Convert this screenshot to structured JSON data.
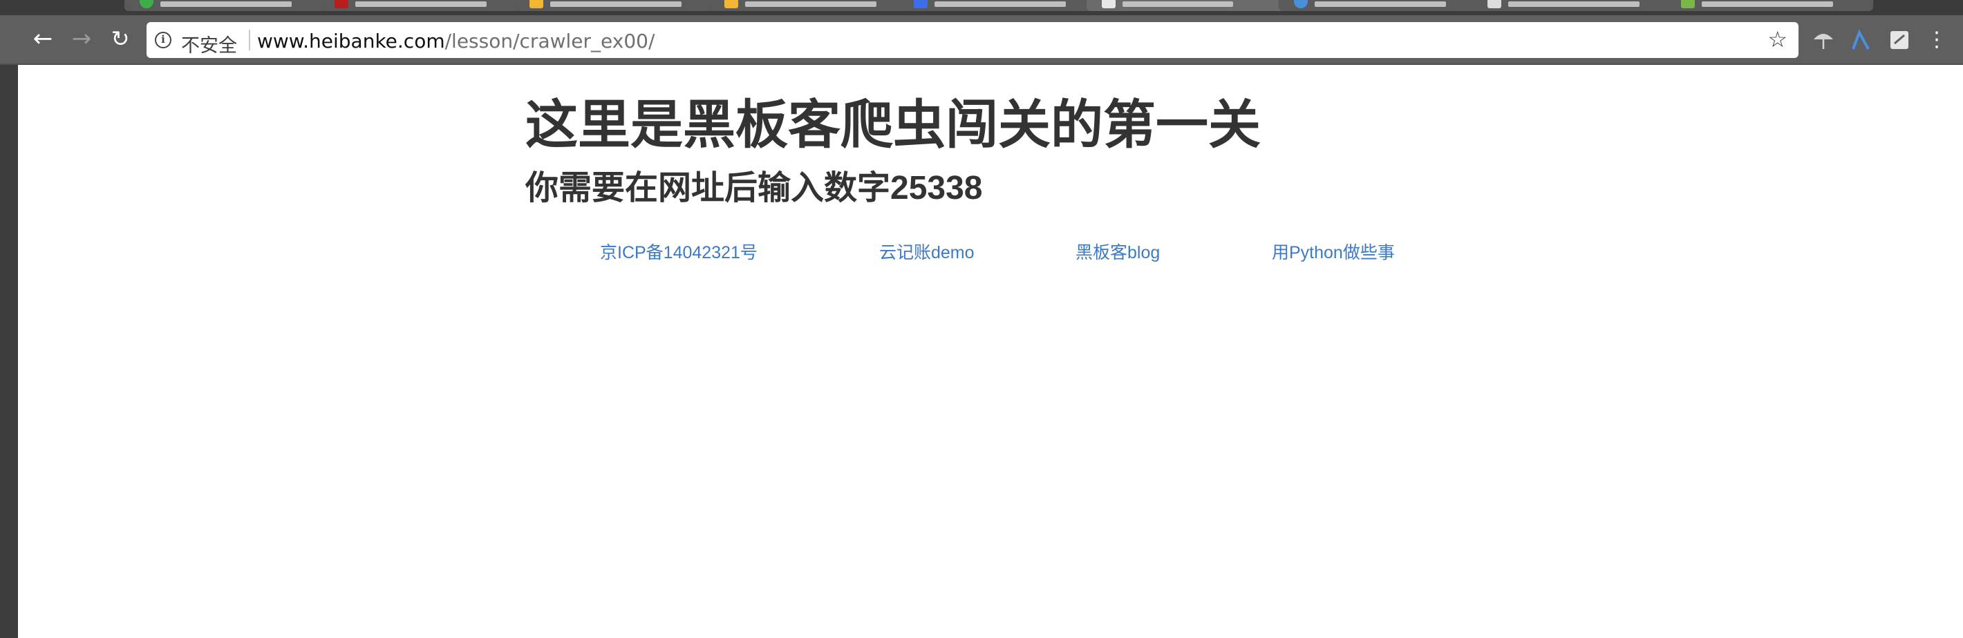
{
  "browser": {
    "security_label": "不安全",
    "url_host": "www.heibanke.com",
    "url_path": "/lesson/crawler_ex00/",
    "icons": {
      "back": "arrow-left-icon",
      "forward": "arrow-right-icon",
      "reload": "reload-icon",
      "info": "info-icon",
      "bookmark": "star-icon",
      "menu": "kebab-menu-icon"
    }
  },
  "page": {
    "heading": "这里是黑板客爬虫闯关的第一关",
    "instruction": "你需要在网址后输入数字25338",
    "footer_links": [
      "京ICP备14042321号",
      "云记账demo",
      "黑板客blog",
      "用Python做些事"
    ]
  },
  "colors": {
    "link": "#3d7ac4",
    "heading": "#333333",
    "toolbar": "#5f5f5f"
  }
}
